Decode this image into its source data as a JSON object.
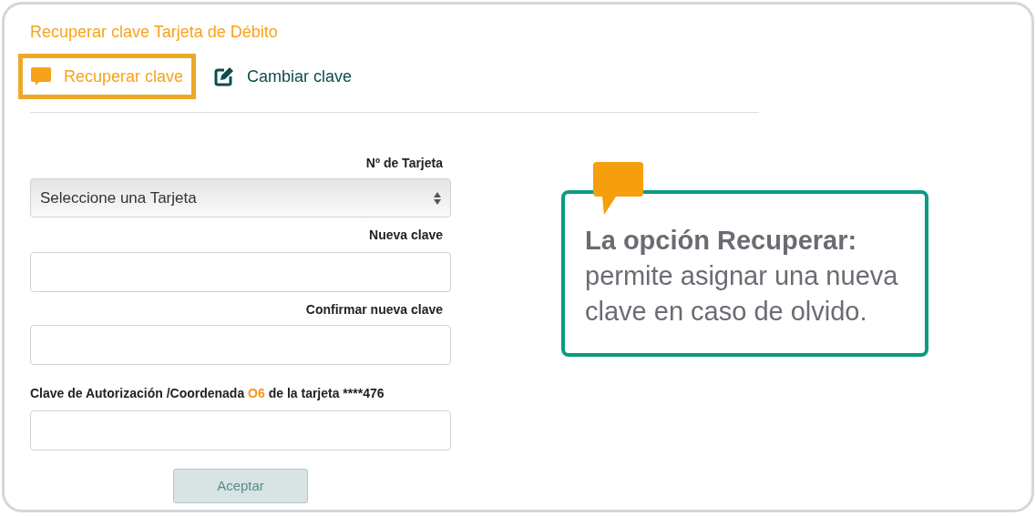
{
  "page_title": "Recuperar clave Tarjeta de Débito",
  "tabs": [
    {
      "label": "Recuperar clave",
      "kind": "bubble",
      "selected": true
    },
    {
      "label": "Cambiar clave",
      "kind": "edit",
      "selected": false
    }
  ],
  "form": {
    "card_label": "Nº de Tarjeta",
    "card_select": {
      "value": "Seleccione una Tarjeta"
    },
    "new_password_label": "Nueva clave",
    "confirm_label": "Confirmar nueva clave",
    "auth_label": {
      "before": "Clave de Autorización /Coordenada",
      "highlight": "O6",
      "after": "de la tarjeta ****476"
    },
    "submit": "Aceptar"
  },
  "callout": {
    "text": "**La opción Recuperar:** permite asignar una nueva clave en caso de olvido."
  }
}
